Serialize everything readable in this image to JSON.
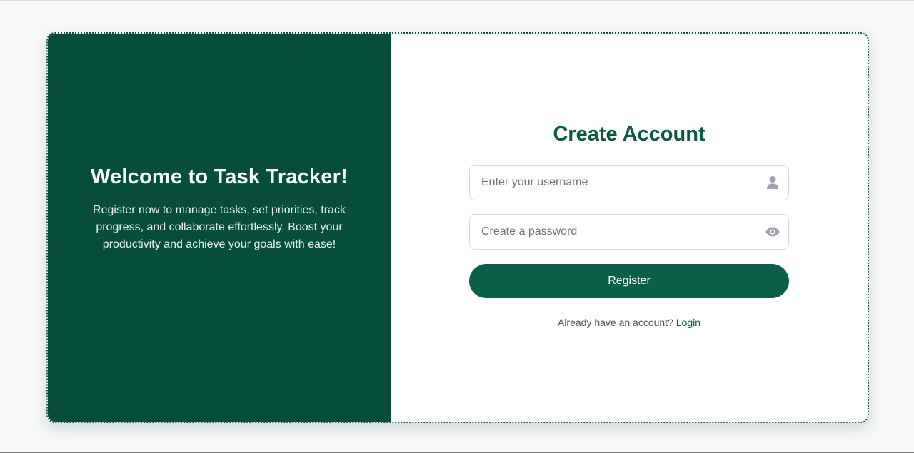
{
  "welcome": {
    "title": "Welcome to Task Tracker!",
    "description": "Register now to manage tasks, set priorities, track progress, and collaborate effortlessly. Boost your productivity and achieve your goals with ease!"
  },
  "form": {
    "title": "Create Account",
    "username": {
      "placeholder": "Enter your username",
      "value": "",
      "icon": "user-icon"
    },
    "password": {
      "placeholder": "Create a password",
      "value": "",
      "icon": "eye-icon"
    },
    "register_label": "Register",
    "login_prompt": "Already have an account?",
    "login_link": "Login"
  },
  "colors": {
    "brand_dark": "#064e3b",
    "brand": "#0a5f48",
    "icon_gray": "#9ca3af"
  }
}
